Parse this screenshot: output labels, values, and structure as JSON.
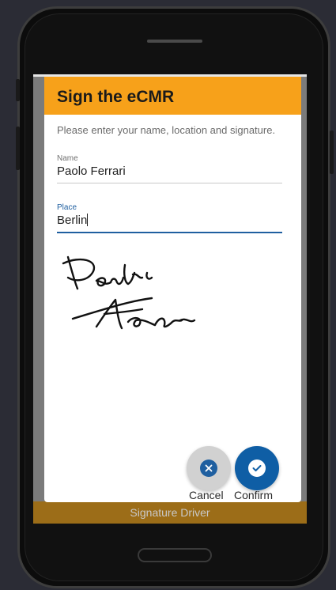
{
  "dialog": {
    "title": "Sign the eCMR",
    "intro": "Please enter your name, location and signature.",
    "name_field": {
      "label": "Name",
      "value": "Paolo Ferrari"
    },
    "place_field": {
      "label": "Place",
      "value": "Berlin"
    },
    "signature_icon": "handwritten-signature",
    "cancel_label": "Cancel",
    "confirm_label": "Confirm"
  },
  "background_screen": {
    "bottom_bar_label": "Signature Driver"
  },
  "colors": {
    "header": "#f7a11a",
    "accent": "#0f5ea5",
    "cancel_button": "#d1d1d1"
  },
  "icons": {
    "cancel": "close-circle-icon",
    "confirm": "check-circle-icon"
  }
}
